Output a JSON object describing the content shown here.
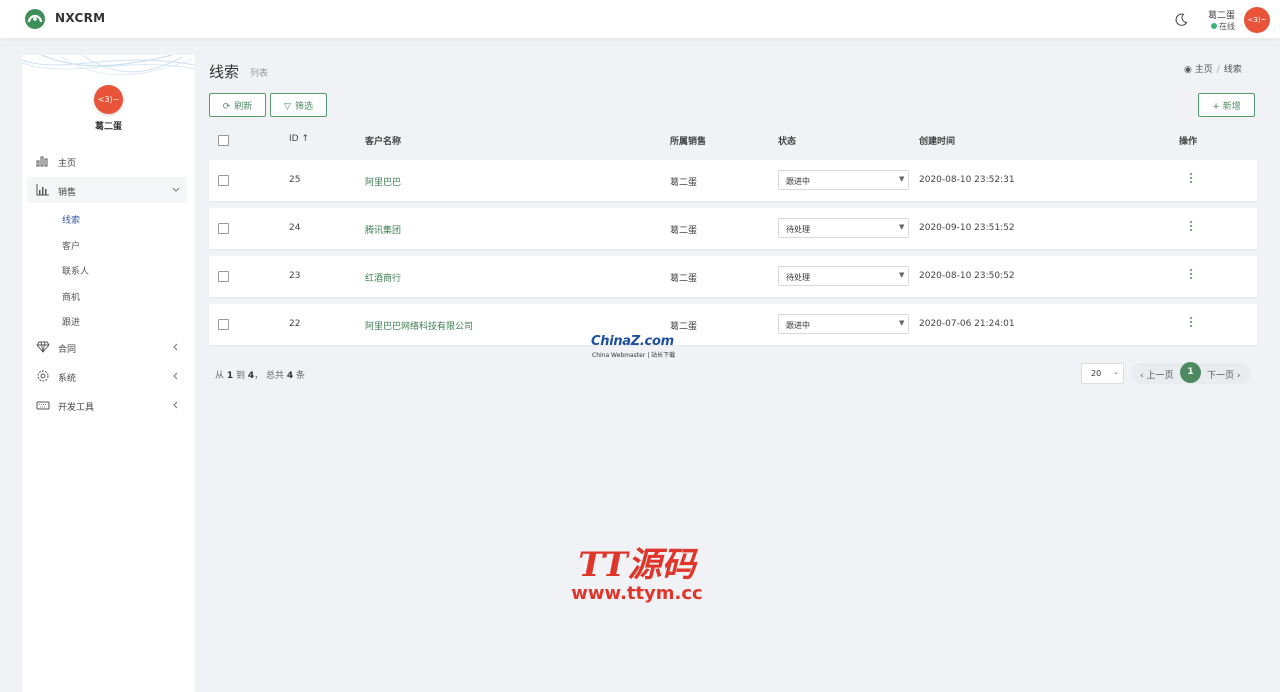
{
  "colors": {
    "accent": "#4d8a62",
    "avatar": "#e8533a",
    "online": "#3cb371",
    "link": "#3c7d52"
  },
  "header": {
    "brand": "NXCRM",
    "user_name": "葛二蛋",
    "user_status": "在线",
    "avatar_text": "<3)~"
  },
  "sidebar": {
    "user_name": "葛二蛋",
    "avatar_text": "<3)~",
    "menu": [
      {
        "label": "主页",
        "icon": "bar-chart-icon"
      },
      {
        "label": "销售",
        "icon": "histogram-icon",
        "expanded": true
      },
      {
        "label": "合同",
        "icon": "diamond-icon"
      },
      {
        "label": "系统",
        "icon": "gear-icon"
      },
      {
        "label": "开发工具",
        "icon": "keyboard-icon"
      }
    ],
    "submenu": [
      "线索",
      "客户",
      "联系人",
      "商机",
      "跟进"
    ]
  },
  "page": {
    "title": "线索",
    "subtitle": "列表"
  },
  "breadcrumb": {
    "home": "主页",
    "current": "线索"
  },
  "toolbar": {
    "refresh": "刷新",
    "filter": "筛选",
    "add": "+ 新增"
  },
  "table": {
    "headers": {
      "id": "ID ↑",
      "name": "客户名称",
      "owner": "所属销售",
      "status": "状态",
      "created": "创建时间",
      "actions": "操作"
    },
    "rows": [
      {
        "id": "25",
        "name": "阿里巴巴",
        "owner": "葛二蛋",
        "status": "跟进中",
        "created": "2020-08-10 23:52:31"
      },
      {
        "id": "24",
        "name": "腾讯集团",
        "owner": "葛二蛋",
        "status": "待处理",
        "created": "2020-09-10 23:51:52"
      },
      {
        "id": "23",
        "name": "红酒商行",
        "owner": "葛二蛋",
        "status": "待处理",
        "created": "2020-08-10 23:50:52"
      },
      {
        "id": "22",
        "name": "阿里巴巴网络科技有限公司",
        "owner": "葛二蛋",
        "status": "跟进中",
        "created": "2020-07-06 21:24:01"
      }
    ]
  },
  "pagination": {
    "summary_pre": "从 ",
    "from": "1",
    "to_word": " 到 ",
    "to": "4",
    "total_word": "， 总共 ",
    "total": "4",
    "unit": " 条",
    "page_size": "20",
    "prev": "‹ 上一页",
    "current": "1",
    "next": "下一页 ›"
  },
  "watermarks": {
    "china_big": "ChinaZ.com",
    "china_small": "China Webmaster | 站长下载",
    "tt_big": "TT源码",
    "tt_url": "www.ttym.cc"
  }
}
